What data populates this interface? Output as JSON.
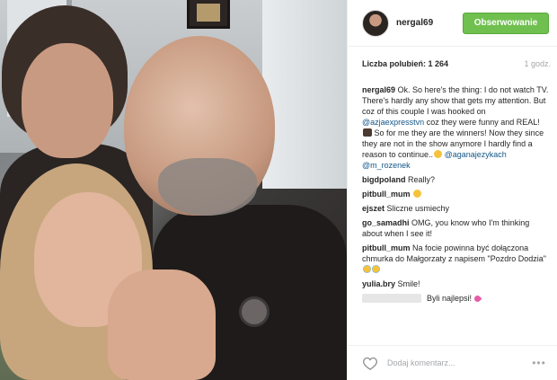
{
  "post": {
    "author": "nergal69",
    "follow_label": "Obserwowanie",
    "likes": "Liczba polubień: 1 264",
    "time": "1 godz."
  },
  "caption": {
    "user": "nergal69",
    "text_1": "Ok. So here's the thing: I do not watch TV. There's hardly any show that gets my attention. But coz of this couple I was hooked on",
    "mention_1": "@azjaexpresstvn",
    "text_2": "coz they were funny and REAL!",
    "text_3": "So for me they are the winners! Now they since they are not in the show anymore I hardly find a reason to continue..",
    "mention_2": "@aganajezykach",
    "mention_3": "@m_rozenek"
  },
  "comments": [
    {
      "user": "bigdpoland",
      "text": "Really?"
    },
    {
      "user": "pitbull_mum",
      "text": ""
    },
    {
      "user": "ejszet",
      "text": "Sliczne usmiechy"
    },
    {
      "user": "go_samadhi",
      "text": "OMG, you know who I'm thinking about when I see it!"
    },
    {
      "user": "pitbull_mum",
      "text": "Na focie powinna być dołączona chmurka do Małgorzaty z napisem \"Pozdro Dodzia\""
    },
    {
      "user": "yulia.bry",
      "text": "Smile!"
    }
  ],
  "redacted_comment": {
    "text": "Byli najlepsi!"
  },
  "footer": {
    "comment_placeholder": "Dodaj komentarz...",
    "more_glyph": "•••"
  },
  "colors": {
    "follow_button": "#70c050",
    "mention": "#125688",
    "muted": "#a5a7aa"
  },
  "icons": {
    "heart": "heart-icon",
    "more": "more-options-icon"
  }
}
